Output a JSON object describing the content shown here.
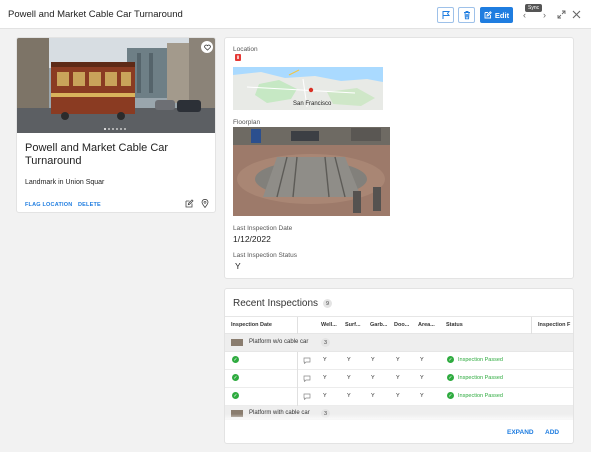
{
  "header": {
    "title": "Powell and Market Cable Car Turnaround",
    "edit_label": "Edit",
    "sync_tooltip": "Sync"
  },
  "place": {
    "name": "Powell and Market Cable Car Turnaround",
    "subtitle": "Landmark in Union Squar",
    "flag_label": "FLAG LOCATION",
    "delete_label": "DELETE",
    "photo_page_count": 6
  },
  "details": {
    "location_label": "Location",
    "map_city_label": "San Francisco",
    "floorplan_label": "Floorplan",
    "last_inspection_date_label": "Last Inspection Date",
    "last_inspection_date": "1/12/2022",
    "last_inspection_status_label": "Last Inspection Status",
    "last_inspection_status": "Y"
  },
  "inspections": {
    "title": "Recent Inspections",
    "count": "9",
    "columns": [
      "Inspection Date",
      "Well...",
      "Surf...",
      "Garb...",
      "Doo...",
      "Area...",
      "Status",
      "Inspection F"
    ],
    "groups": [
      {
        "label": "Platform w/o cable car",
        "count": "3"
      },
      {
        "label": "Platform with cable car",
        "count": "3"
      }
    ],
    "rows": [
      {
        "values": [
          "Y",
          "Y",
          "Y",
          "Y",
          "Y"
        ],
        "status": "Inspection Passed"
      },
      {
        "values": [
          "Y",
          "Y",
          "Y",
          "Y",
          "Y"
        ],
        "status": "Inspection Passed"
      },
      {
        "values": [
          "Y",
          "Y",
          "Y",
          "Y",
          "Y"
        ],
        "status": "Inspection Passed"
      }
    ],
    "expand_label": "EXPAND",
    "add_label": "ADD"
  },
  "colors": {
    "accent": "#1f7de0",
    "success": "#2eab3f",
    "danger": "#e53935"
  }
}
